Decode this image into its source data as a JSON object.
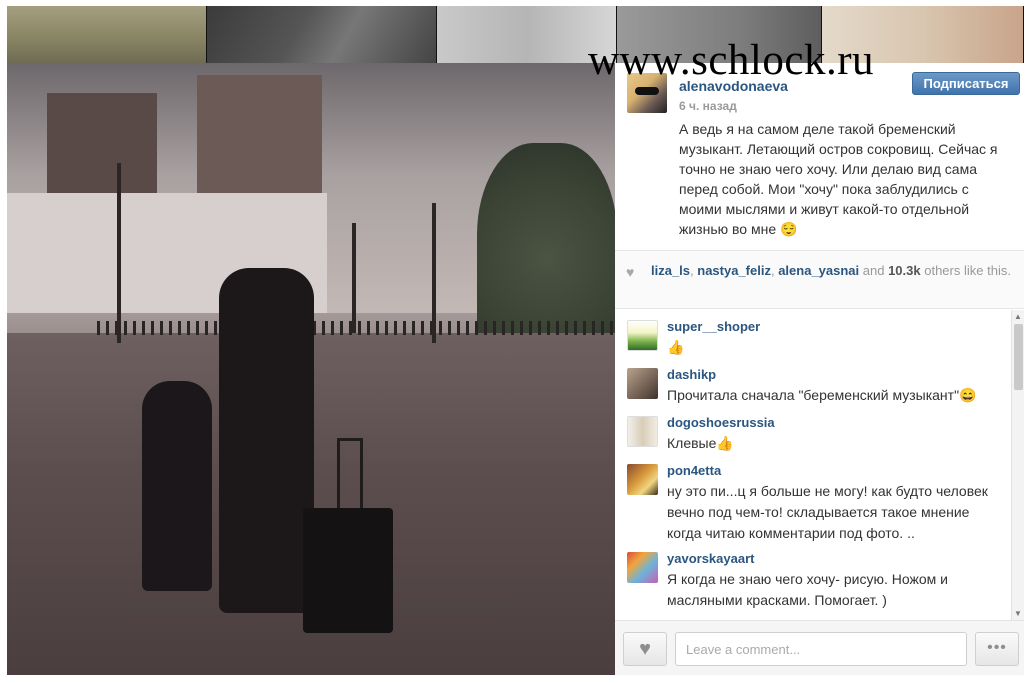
{
  "watermark": "www.schlock.ru",
  "post": {
    "username": "alenavodonaeva",
    "time": "6 ч. назад",
    "follow_label": "Подписаться",
    "caption": "А ведь я на самом деле такой бременский музыкант. Летающий остров сокровищ. Сейчас я точно не знаю чего хочу. Или делаю вид сама перед собой. Мои \"хочу\" пока заблудились с моими мыслями и живут какой-то отдельной жизнью во мне 😌"
  },
  "likes": {
    "users": [
      "liza_ls",
      "nastya_feliz",
      "alena_yasnai"
    ],
    "sep1": ", ",
    "sep2": ", ",
    "and": " and ",
    "count": "10.3k",
    "suffix": " others like this."
  },
  "comments": [
    {
      "user": "super__shoper",
      "text": "👍"
    },
    {
      "user": "dashikp",
      "text": "Прочитала сначала \"беременский музыкант\"😄"
    },
    {
      "user": "dogoshoesrussia",
      "text": "Клевые👍"
    },
    {
      "user": "pon4etta",
      "text": "ну это пи...ц я больше не могу! как будто человек вечно под чем-то! складывается такое мнение когда читаю комментарии под фото. .."
    },
    {
      "user": "yavorskayaart",
      "text": "Я когда не знаю чего хочу- рисую. Ножом и масляными красками. Помогает. )"
    }
  ],
  "footer": {
    "comment_placeholder": "Leave a comment...",
    "more_label": "•••",
    "heart_glyph": "♥"
  },
  "icons": {
    "heart": "heart-icon",
    "more": "ellipsis-icon"
  }
}
